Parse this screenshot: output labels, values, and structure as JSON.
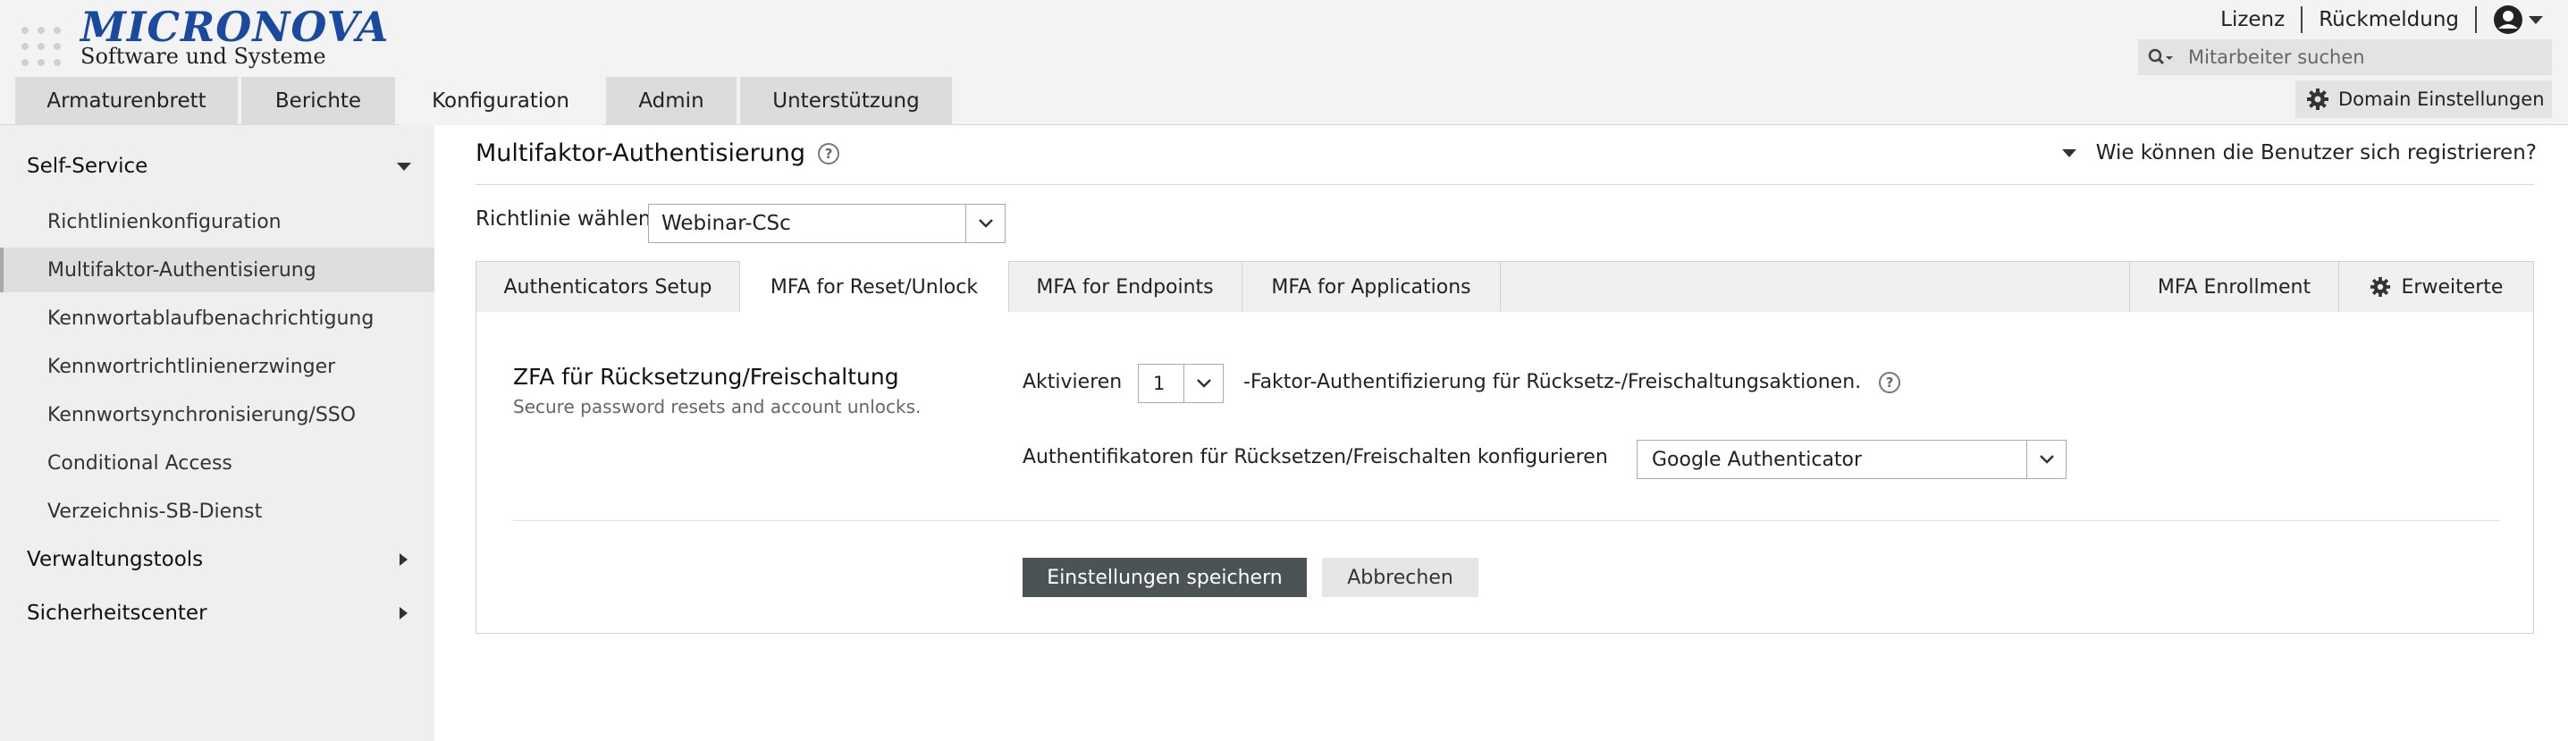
{
  "header": {
    "logo": {
      "title": "MICRONOVA",
      "subtitle": "Software und Systeme"
    },
    "top_links": {
      "license": "Lizenz",
      "feedback": "Rückmeldung"
    },
    "search": {
      "placeholder": "Mitarbeiter suchen",
      "value": ""
    },
    "domain_settings": "Domain Einstellungen",
    "icons": [
      "app-grid-icon",
      "user-icon",
      "search-icon",
      "gear-icon"
    ]
  },
  "main_nav": {
    "tabs": [
      {
        "label": "Armaturenbrett",
        "active": false
      },
      {
        "label": "Berichte",
        "active": false
      },
      {
        "label": "Konfiguration",
        "active": true
      },
      {
        "label": "Admin",
        "active": false
      },
      {
        "label": "Unterstützung",
        "active": false
      }
    ]
  },
  "sidebar": {
    "sections": [
      {
        "label": "Self-Service",
        "expanded": true,
        "items": [
          {
            "label": "Richtlinienkonfiguration",
            "active": false
          },
          {
            "label": "Multifaktor-Authentisierung",
            "active": true
          },
          {
            "label": "Kennwortablaufbenachrichtigung",
            "active": false
          },
          {
            "label": "Kennwortrichtlinienerzwinger",
            "active": false
          },
          {
            "label": "Kennwortsynchronisierung/SSO",
            "active": false
          },
          {
            "label": "Conditional Access",
            "active": false
          },
          {
            "label": "Verzeichnis-SB-Dienst",
            "active": false
          }
        ]
      },
      {
        "label": "Verwaltungstools",
        "expanded": false
      },
      {
        "label": "Sicherheitscenter",
        "expanded": false
      }
    ]
  },
  "content": {
    "title": "Multifaktor-Authentisierung",
    "help_link": "Wie können die Benutzer sich registrieren?",
    "policy": {
      "label": "Richtlinie wählen",
      "value": "Webinar-CSc"
    },
    "tabs": [
      {
        "label": "Authenticators Setup",
        "active": false
      },
      {
        "label": "MFA for Reset/Unlock",
        "active": true
      },
      {
        "label": "MFA for Endpoints",
        "active": false
      },
      {
        "label": "MFA for Applications",
        "active": false
      },
      {
        "label": "MFA Enrollment",
        "active": false
      },
      {
        "label": "Erweiterte",
        "active": false
      }
    ],
    "section": {
      "title": "ZFA für Rücksetzung/Freischaltung",
      "description": "Secure password resets and account unlocks.",
      "activate_label": "Aktivieren",
      "factor_value": "1",
      "factor_suffix": "-Faktor-Authentifizierung für Rücksetz-/Freischaltungsaktionen.",
      "authenticators_label": "Authentifikatoren für Rücksetzen/Freischalten konfigurieren",
      "authenticators_value": "Google Authenticator"
    },
    "buttons": {
      "save": "Einstellungen speichern",
      "cancel": "Abbrechen"
    }
  },
  "colors": {
    "logo_blue": "#1a4aa0",
    "save_button": "#4c5355",
    "sidebar_bg": "#efefef",
    "header_bg": "#f3f3f3"
  }
}
